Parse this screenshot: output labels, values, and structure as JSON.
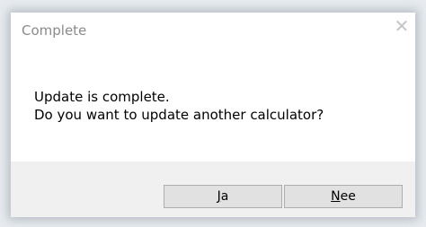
{
  "window": {
    "title": "Complete",
    "close_glyph": "✕"
  },
  "message": {
    "line1": "Update is complete.",
    "line2": "Do you want to update another calculator?"
  },
  "buttons": {
    "yes": {
      "mnemonic": "J",
      "rest": "a",
      "label": "Ja"
    },
    "no": {
      "mnemonic": "N",
      "rest": "ee",
      "label": "Nee"
    }
  },
  "colors": {
    "title_text": "#8a8a8a",
    "footer_bg": "#f0f0f0",
    "button_bg": "#e1e1e1",
    "button_border": "#adadad"
  }
}
